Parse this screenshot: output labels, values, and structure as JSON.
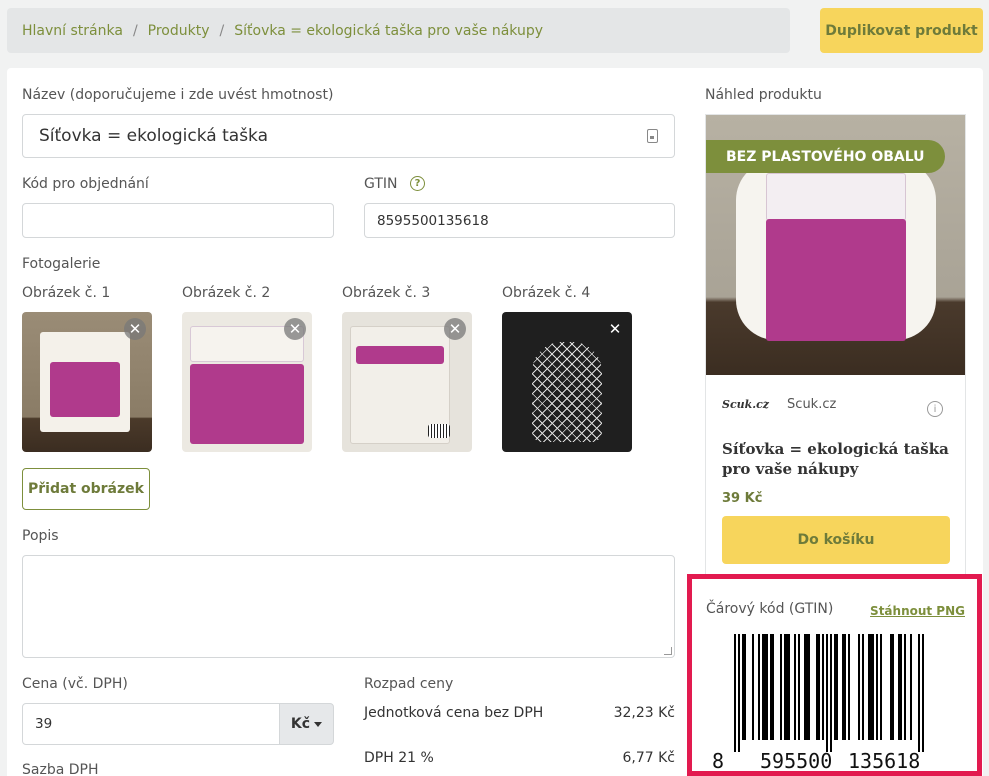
{
  "breadcrumb": {
    "home": "Hlavní stránka",
    "products": "Produkty",
    "current": "Síťovka = ekologická taška pro vaše nákupy",
    "separator": "/"
  },
  "header": {
    "duplicate_button": "Duplikovat produkt"
  },
  "form": {
    "name_label": "Název (doporučujeme i zde uvést hmotnost)",
    "name_value": "Síťovka = ekologická taška",
    "order_code_label": "Kód pro objednání",
    "order_code_value": "",
    "gtin_label": "GTIN",
    "gtin_help": "?",
    "gtin_value": "8595500135618",
    "gallery_label": "Fotogalerie",
    "images": [
      {
        "label": "Obrázek č. 1"
      },
      {
        "label": "Obrázek č. 2"
      },
      {
        "label": "Obrázek č. 3"
      },
      {
        "label": "Obrázek č. 4"
      }
    ],
    "close_glyph": "✕",
    "add_image_button": "Přidat obrázek",
    "description_label": "Popis",
    "description_value": "",
    "price_label": "Cena (vč. DPH)",
    "price_value": "39",
    "currency": "Kč",
    "vat_label": "Sazba DPH"
  },
  "price_breakdown": {
    "title": "Rozpad ceny",
    "rows": [
      {
        "label": "Jednotková cena bez DPH",
        "value": "32,23 Kč"
      },
      {
        "label": "DPH 21 %",
        "value": "6,77 Kč"
      }
    ]
  },
  "preview": {
    "title": "Náhled produktu",
    "badge": "BEZ PLASTOVÉHO OBALU",
    "shop_logo": "Scuk.cz",
    "shop_name": "Scuk.cz",
    "info_glyph": "i",
    "product_title": "Síťovka = ekologická taška pro vaše nákupy",
    "price": "39 Kč",
    "cart_button": "Do košíku"
  },
  "barcode": {
    "label": "Čárový kód (GTIN)",
    "download_link": "Stáhnout PNG",
    "digits_first": "8",
    "digits_left": "595500",
    "digits_right": "135618"
  },
  "colors": {
    "accent_green": "#7d8f3c",
    "button_yellow": "#f7d55c",
    "highlight_red": "#e21a4f",
    "pack_magenta": "#b03a8c"
  }
}
